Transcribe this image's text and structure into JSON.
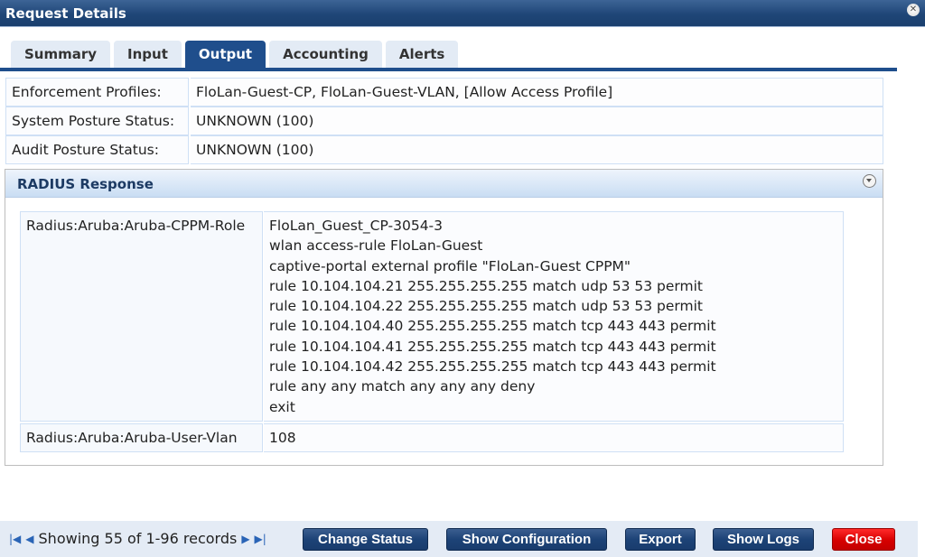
{
  "window": {
    "title": "Request Details",
    "close_icon": "close-circle-icon"
  },
  "tabs": [
    {
      "label": "Summary",
      "active": false
    },
    {
      "label": "Input",
      "active": false
    },
    {
      "label": "Output",
      "active": true
    },
    {
      "label": "Accounting",
      "active": false
    },
    {
      "label": "Alerts",
      "active": false
    }
  ],
  "properties": [
    {
      "label": "Enforcement Profiles:",
      "value": "FloLan-Guest-CP, FloLan-Guest-VLAN, [Allow Access Profile]"
    },
    {
      "label": "System Posture Status:",
      "value": "UNKNOWN (100)"
    },
    {
      "label": "Audit Posture Status:",
      "value": "UNKNOWN (100)"
    }
  ],
  "radius_panel": {
    "title": "RADIUS Response",
    "collapse_icon": "collapse-toggle-icon",
    "attributes": [
      {
        "name": "Radius:Aruba:Aruba-CPPM-Role",
        "lines": [
          "FloLan_Guest_CP-3054-3",
          "wlan access-rule FloLan-Guest",
          "captive-portal external profile \"FloLan-Guest CPPM\"",
          "rule 10.104.104.21 255.255.255.255 match udp 53 53 permit",
          "rule 10.104.104.22 255.255.255.255 match udp 53 53 permit",
          "rule 10.104.104.40 255.255.255.255 match tcp 443 443 permit",
          "rule 10.104.104.41 255.255.255.255 match tcp 443 443 permit",
          "rule 10.104.104.42 255.255.255.255 match tcp 443 443 permit",
          "rule any any match any any any deny",
          "exit"
        ]
      },
      {
        "name": "Radius:Aruba:Aruba-User-Vlan",
        "lines": [
          "108"
        ]
      }
    ]
  },
  "footer": {
    "pager_text": "Showing 55 of 1-96 records",
    "first_icon": "⏮",
    "prev_icon": "◀",
    "next_icon": "▶",
    "last_icon": "⏭",
    "buttons": {
      "change_status": "Change Status",
      "show_configuration": "Show Configuration",
      "export": "Export",
      "show_logs": "Show Logs",
      "close": "Close"
    },
    "close_color": "#d60000",
    "button_color": "#1d4377"
  }
}
